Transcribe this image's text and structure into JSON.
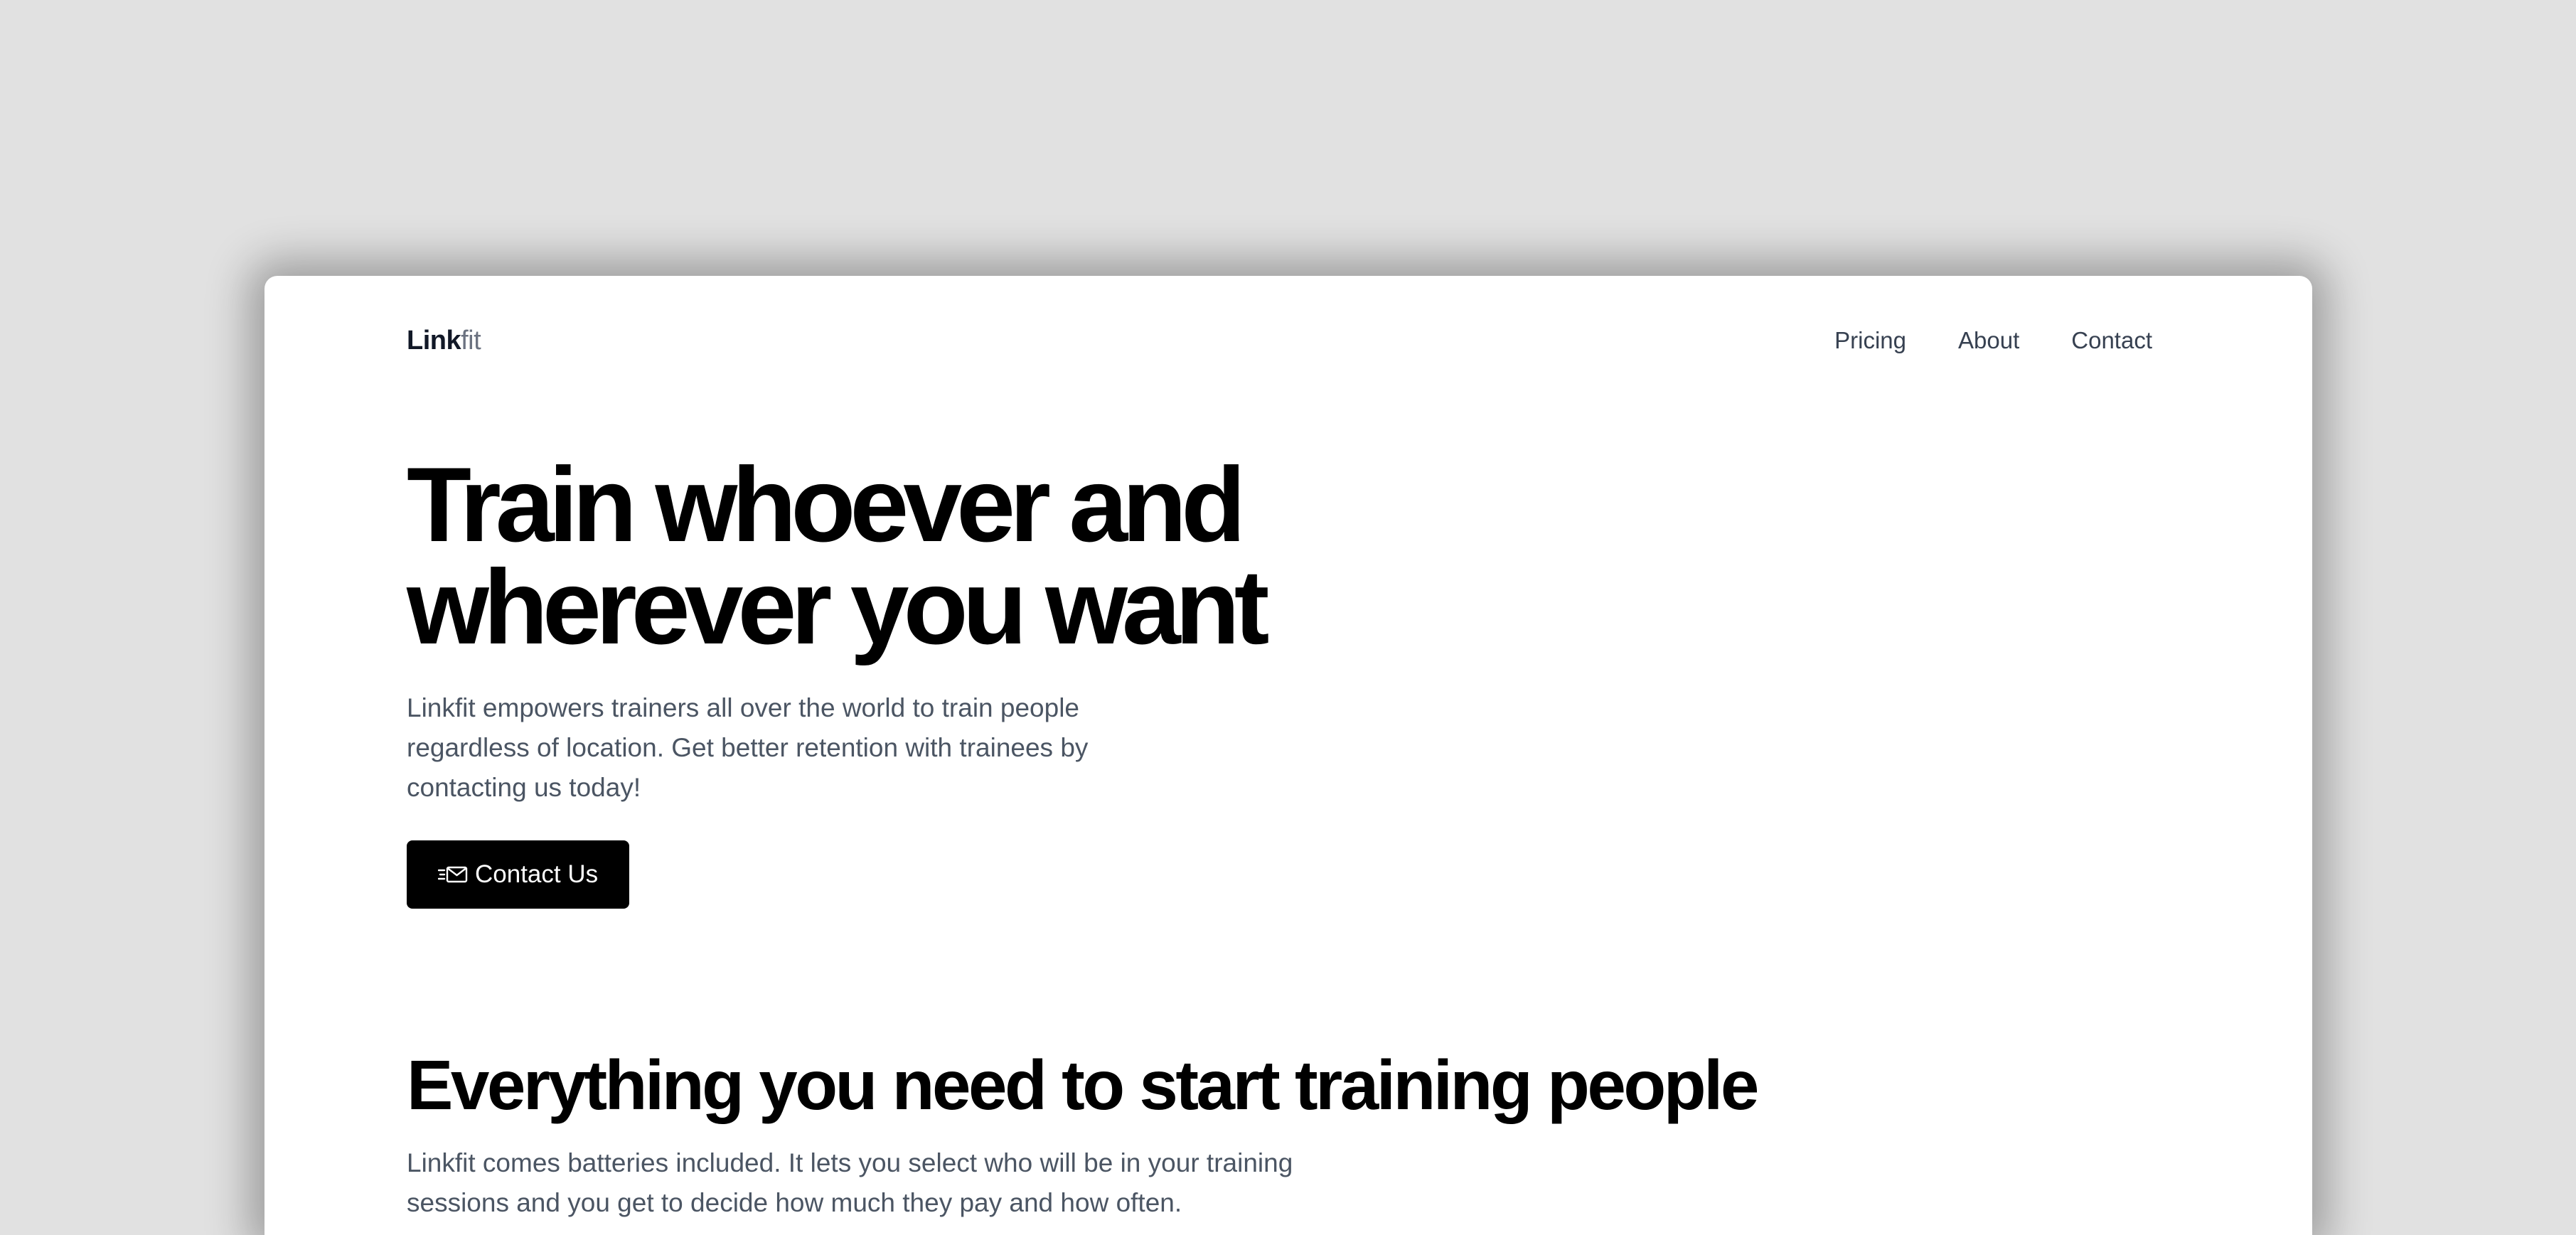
{
  "header": {
    "logo_bold": "Link",
    "logo_light": "fit",
    "nav": [
      {
        "label": "Pricing"
      },
      {
        "label": "About"
      },
      {
        "label": "Contact"
      }
    ]
  },
  "hero": {
    "title_line1": "Train whoever and",
    "title_line2": "wherever you want",
    "subtitle": "Linkfit empowers trainers all over the world to train people regardless of location. Get better retention with trainees by contacting us today!",
    "cta_label": "Contact Us",
    "cta_icon": "send-mail-icon"
  },
  "features": {
    "title": "Everything you need to start training people",
    "text": "Linkfit comes batteries included. It lets you select who will be in your training sessions and you get to decide how much they pay and how often."
  }
}
